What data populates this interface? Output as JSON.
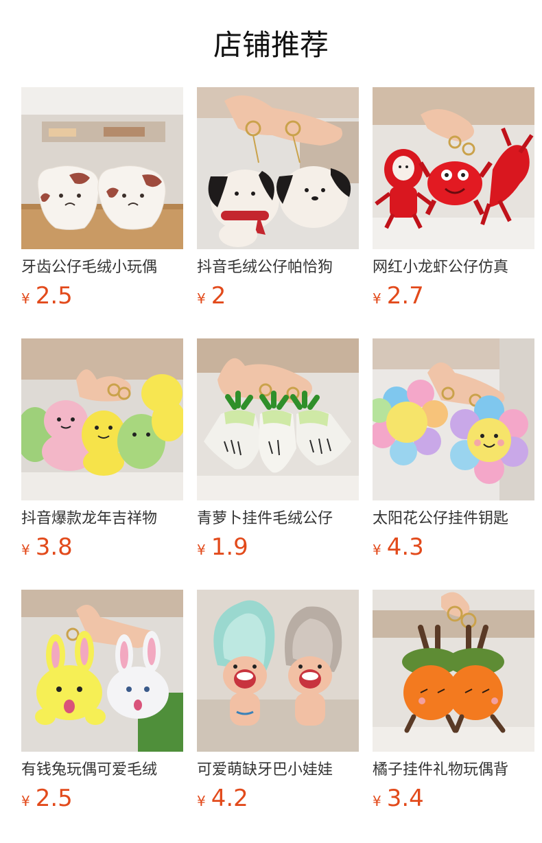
{
  "section_title": "店铺推荐",
  "currency_symbol": "¥",
  "products": [
    {
      "name": "牙齿公仔毛绒小玩偶",
      "price": "2.5",
      "image": "tooth-plush-image"
    },
    {
      "name": "抖音毛绒公仔帕恰狗",
      "price": "2",
      "image": "pochacco-keychain-image"
    },
    {
      "name": "网红小龙虾公仔仿真",
      "price": "2.7",
      "image": "crayfish-plush-image"
    },
    {
      "name": "抖音爆款龙年吉祥物",
      "price": "3.8",
      "image": "dragon-plush-image"
    },
    {
      "name": "青萝卜挂件毛绒公仔",
      "price": "1.9",
      "image": "radish-keychain-image"
    },
    {
      "name": "太阳花公仔挂件钥匙",
      "price": "4.3",
      "image": "sunflower-keychain-image"
    },
    {
      "name": "有钱兔玩偶可爱毛绒",
      "price": "2.5",
      "image": "rabbit-keychain-image"
    },
    {
      "name": "可爱萌缺牙巴小娃娃",
      "price": "4.2",
      "image": "troll-doll-image"
    },
    {
      "name": "橘子挂件礼物玩偶背",
      "price": "3.4",
      "image": "orange-keychain-image"
    }
  ]
}
